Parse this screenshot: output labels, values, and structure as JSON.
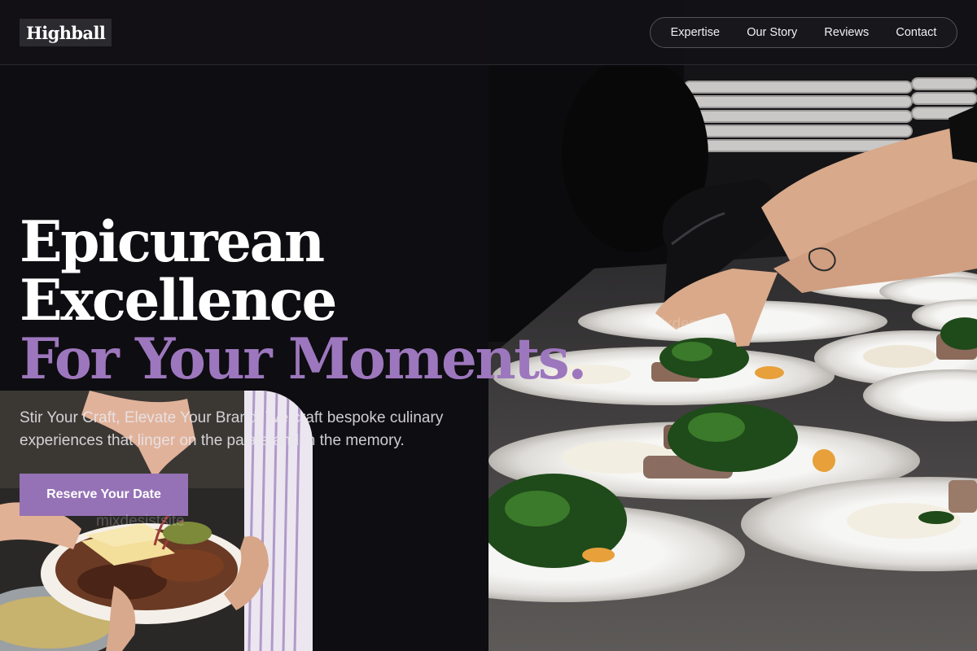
{
  "brand": {
    "logo_text": "Highball"
  },
  "nav": {
    "items": [
      "Expertise",
      "Our Story",
      "Reviews",
      "Contact"
    ]
  },
  "hero": {
    "headline_line1": "Epicurean",
    "headline_line2": "Excellence",
    "headline_line3": "For Your Moments.",
    "subtext": "Stir Your Craft, Elevate Your Brand. We craft bespoke culinary experiences that linger on the palate and in the memory.",
    "cta_label": "Reserve Your Date"
  },
  "watermarks": {
    "right": "mixdesist",
    "left": "mixdesistsite"
  },
  "colors": {
    "accent": "#9d77bd",
    "button": "#9572b5",
    "background": "#0e0d12"
  }
}
